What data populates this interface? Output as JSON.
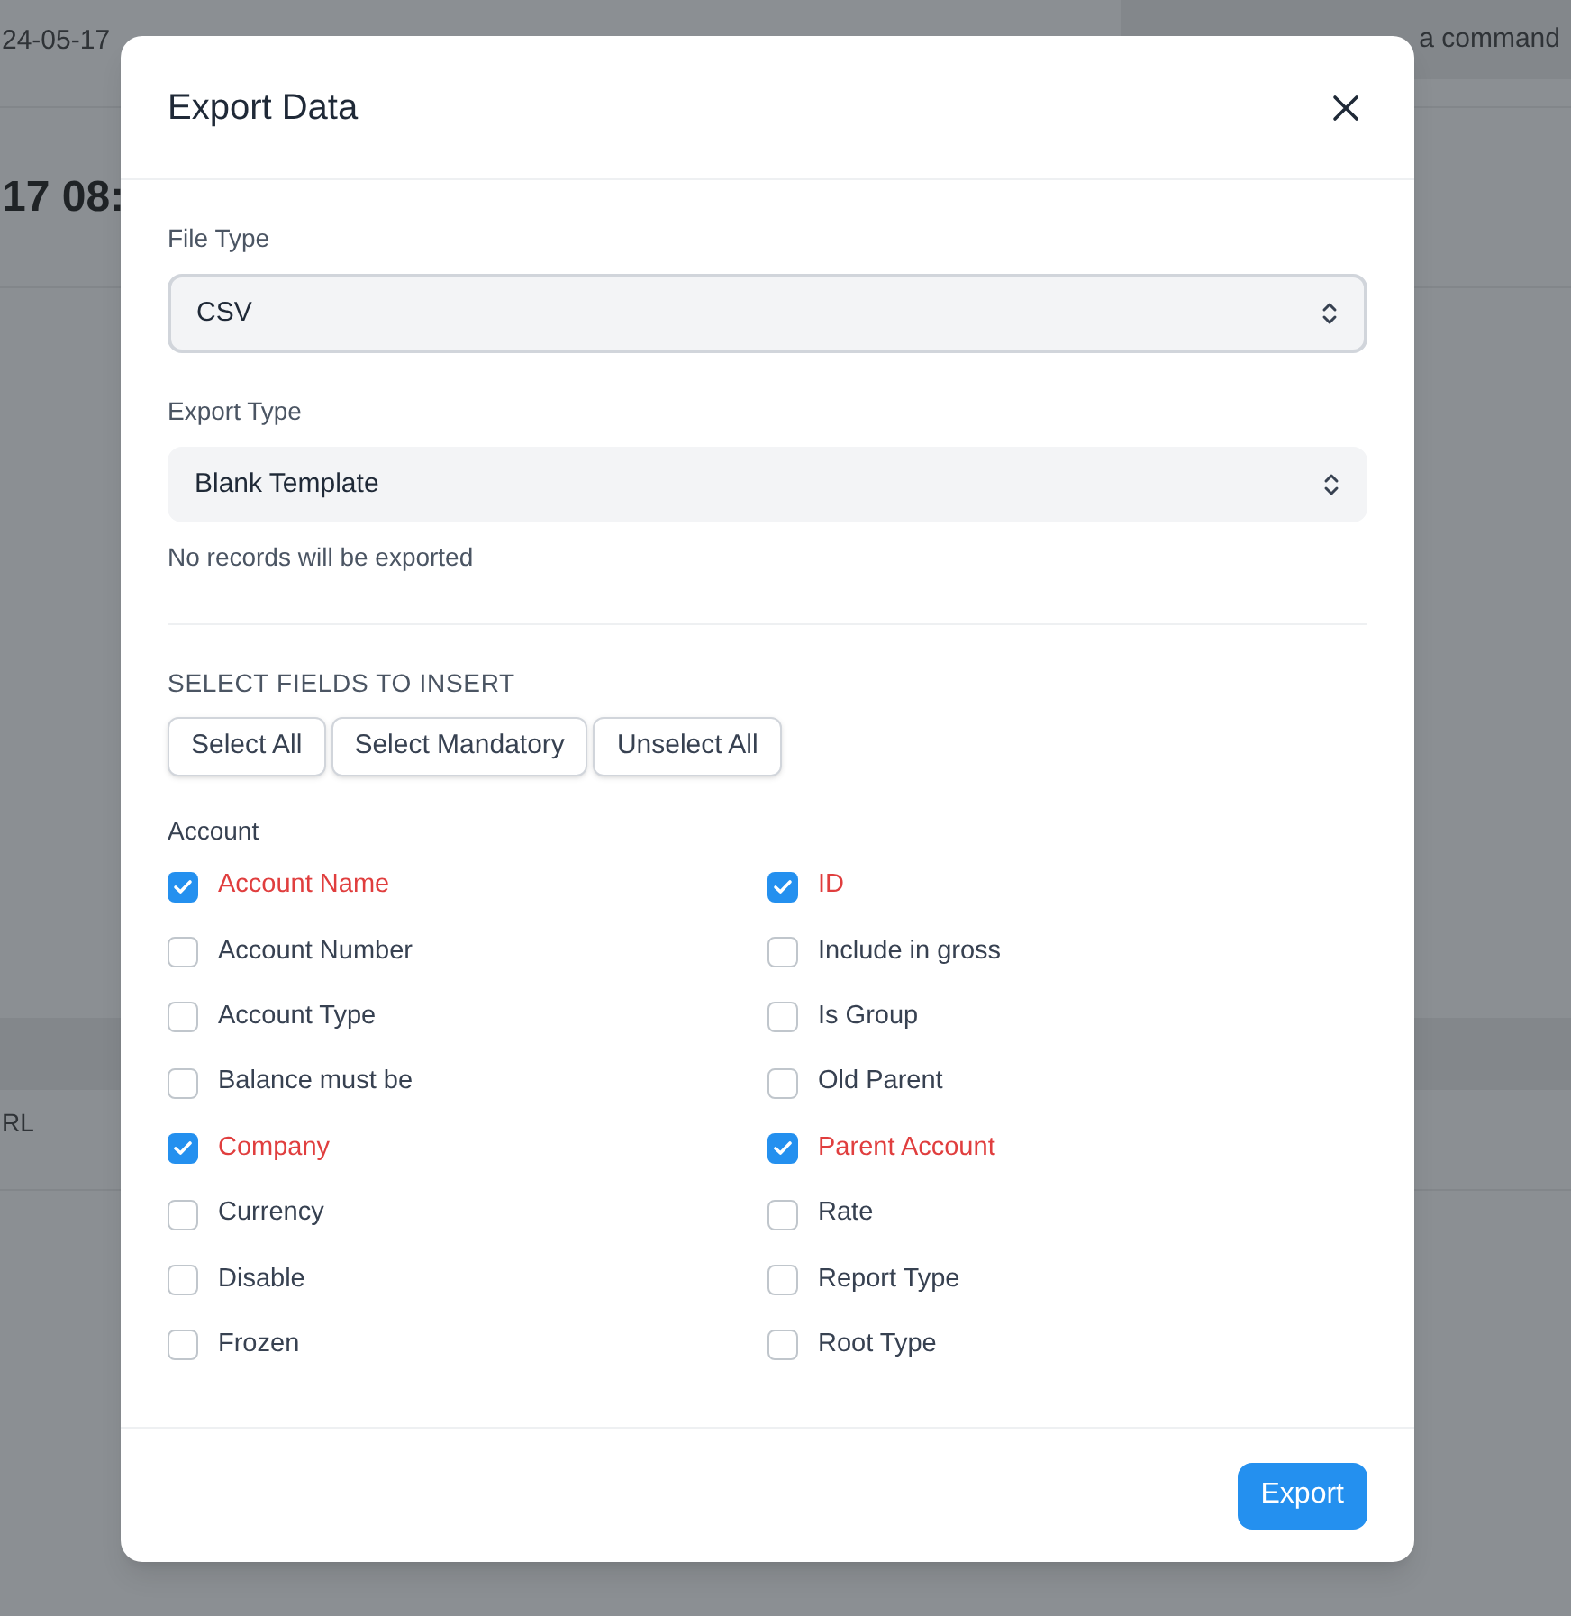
{
  "background": {
    "timestamp": "24-05-17",
    "search": {
      "placeholder": "a command"
    },
    "heading": "17 08:",
    "table_cell": "RL"
  },
  "dialog": {
    "title": "Export Data",
    "file_type": {
      "label": "File Type",
      "value": "CSV"
    },
    "export_type": {
      "label": "Export Type",
      "value": "Blank Template",
      "description": "No records will be exported"
    },
    "section_title": "SELECT FIELDS TO INSERT",
    "buttons": [
      "Select All",
      "Select Mandatory",
      "Unselect All"
    ],
    "group": "Account",
    "fields": [
      {
        "label": "Account Name",
        "checked": true,
        "mandatory": true
      },
      {
        "label": "ID",
        "checked": true,
        "mandatory": true
      },
      {
        "label": "Account Number",
        "checked": false,
        "mandatory": false
      },
      {
        "label": "Include in gross",
        "checked": false,
        "mandatory": false
      },
      {
        "label": "Account Type",
        "checked": false,
        "mandatory": false
      },
      {
        "label": "Is Group",
        "checked": false,
        "mandatory": false
      },
      {
        "label": "Balance must be",
        "checked": false,
        "mandatory": false
      },
      {
        "label": "Old Parent",
        "checked": false,
        "mandatory": false
      },
      {
        "label": "Company",
        "checked": true,
        "mandatory": true
      },
      {
        "label": "Parent Account",
        "checked": true,
        "mandatory": true
      },
      {
        "label": "Currency",
        "checked": false,
        "mandatory": false
      },
      {
        "label": "Rate",
        "checked": false,
        "mandatory": false
      },
      {
        "label": "Disable",
        "checked": false,
        "mandatory": false
      },
      {
        "label": "Report Type",
        "checked": false,
        "mandatory": false
      },
      {
        "label": "Frozen",
        "checked": false,
        "mandatory": false
      },
      {
        "label": "Root Type",
        "checked": false,
        "mandatory": false
      }
    ],
    "primary_button": "Export"
  }
}
